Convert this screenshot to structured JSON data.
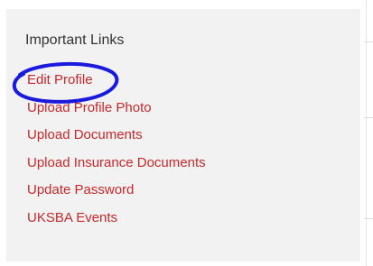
{
  "section": {
    "title": "Important Links"
  },
  "links": [
    {
      "label": "Edit Profile"
    },
    {
      "label": "Upload Profile Photo"
    },
    {
      "label": "Upload Documents"
    },
    {
      "label": "Upload Insurance Documents"
    },
    {
      "label": "Update Password"
    },
    {
      "label": "UKSBA Events"
    }
  ],
  "colors": {
    "panel_bg": "#f2f2f2",
    "link": "#c8282b",
    "heading": "#333333",
    "annotation": "#1a1adf"
  },
  "annotation": {
    "shape": "hand-drawn-circle",
    "target": "Edit Profile"
  }
}
